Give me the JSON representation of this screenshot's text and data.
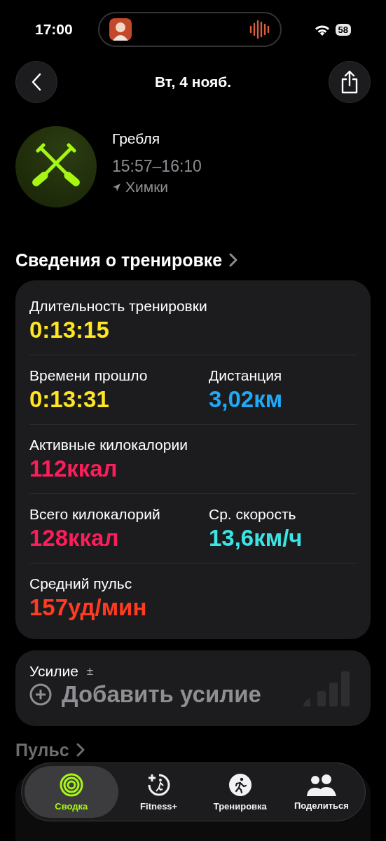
{
  "status_bar": {
    "time": "17:00",
    "battery": "58"
  },
  "nav": {
    "title": "Вт, 4 нояб."
  },
  "workout": {
    "name": "Гребля",
    "time_range": "15:57–16:10",
    "location": "Химки"
  },
  "details_title": "Сведения о тренировке",
  "stats": [
    {
      "items": [
        {
          "label": "Длительность тренировки",
          "value": "0:13:15",
          "color": "#ffe620"
        }
      ]
    },
    {
      "items": [
        {
          "label": "Времени прошло",
          "value": "0:13:31",
          "color": "#ffe620"
        },
        {
          "label": "Дистанция",
          "value": "3,02км",
          "color": "#1eaaf7"
        }
      ]
    },
    {
      "items": [
        {
          "label": "Активные килокалории",
          "value": "112ккал",
          "color": "#fa1e5a"
        }
      ]
    },
    {
      "items": [
        {
          "label": "Всего килокалорий",
          "value": "128ккал",
          "color": "#fa1e5a"
        },
        {
          "label": "Ср. скорость",
          "value": "13,6км/ч",
          "color": "#3ce5e5"
        }
      ]
    },
    {
      "items": [
        {
          "label": "Средний пульс",
          "value": "157уд/мин",
          "color": "#ff3b22"
        }
      ]
    }
  ],
  "effort": {
    "label": "Усилие",
    "symbol": "±",
    "action": "Добавить усилие"
  },
  "next_section": "Пульс",
  "tabs": [
    {
      "label": "Сводка",
      "selected": true
    },
    {
      "label": "Fitness+",
      "selected": false
    },
    {
      "label": "Тренировка",
      "selected": false
    },
    {
      "label": "Поделиться",
      "selected": false
    }
  ]
}
